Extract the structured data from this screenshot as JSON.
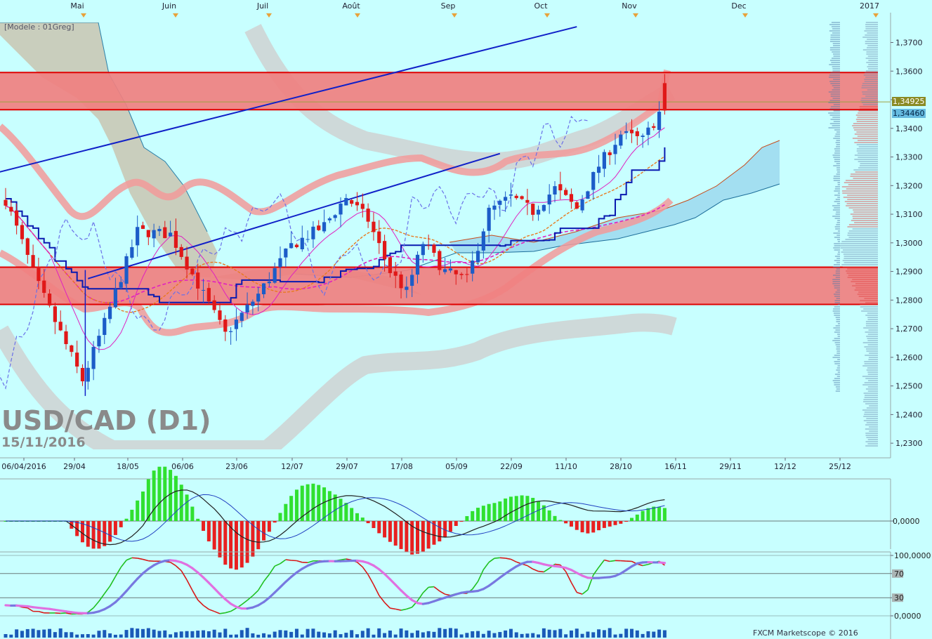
{
  "chart_data": {
    "type": "candlestick",
    "title": "USD/CAD (D1)",
    "subtitle": "15/11/2016",
    "model_label": "[Modele : 01Greg]",
    "footer": "FXCM Marketscope © 2016",
    "months": [
      "Mai",
      "Juin",
      "Juil",
      "Août",
      "Sep",
      "Oct",
      "Nov",
      "Dec",
      "2017"
    ],
    "x_dates": [
      "06/04/2016",
      "29/04",
      "18/05",
      "06/06",
      "23/06",
      "12/07",
      "29/07",
      "17/08",
      "05/09",
      "22/09",
      "11/10",
      "28/10",
      "16/11",
      "29/11",
      "12/12",
      "25/12"
    ],
    "y_ticks": [
      "1,3700",
      "1,3600",
      "1,3500",
      "1,3400",
      "1,3300",
      "1,3200",
      "1,3100",
      "1,3000",
      "1,2900",
      "1,2800",
      "1,2700",
      "1,2600",
      "1,2500",
      "1,2400",
      "1,2300"
    ],
    "y_range": [
      1.2275,
      1.3765
    ],
    "price_labels": {
      "last": "1,34925",
      "bid": "1,34460"
    },
    "zones": [
      {
        "from": 1.3465,
        "to": 1.3595,
        "color": "#f08080"
      },
      {
        "from": 1.2785,
        "to": 1.2915,
        "color": "#f08080"
      }
    ],
    "channel_lines": [
      {
        "from": [
          15,
          1.2875
        ],
        "to": [
          90,
          1.3312
        ]
      },
      {
        "from": [
          -12,
          1.3195
        ],
        "to": [
          104,
          1.3755
        ]
      }
    ],
    "anchors": [
      [
        0,
        1.315
      ],
      [
        6,
        1.285
      ],
      [
        14,
        1.252
      ],
      [
        18,
        1.272
      ],
      [
        24,
        1.304
      ],
      [
        30,
        1.303
      ],
      [
        36,
        1.282
      ],
      [
        40,
        1.268
      ],
      [
        46,
        1.282
      ],
      [
        52,
        1.299
      ],
      [
        58,
        1.306
      ],
      [
        62,
        1.316
      ],
      [
        66,
        1.308
      ],
      [
        70,
        1.29
      ],
      [
        73,
        1.283
      ],
      [
        76,
        1.3
      ],
      [
        80,
        1.29
      ],
      [
        84,
        1.287
      ],
      [
        88,
        1.311
      ],
      [
        92,
        1.316
      ],
      [
        96,
        1.311
      ],
      [
        100,
        1.319
      ],
      [
        104,
        1.312
      ],
      [
        108,
        1.327
      ],
      [
        112,
        1.338
      ],
      [
        116,
        1.336
      ],
      [
        118,
        1.342
      ],
      [
        120,
        1.349
      ]
    ],
    "candles": [],
    "macd": {
      "ylabel": "0,0000"
    },
    "stochastic": {
      "ticks": [
        "100,0000",
        "70",
        "30",
        "0,0000"
      ],
      "levels": [
        100,
        70,
        30,
        0
      ]
    }
  }
}
